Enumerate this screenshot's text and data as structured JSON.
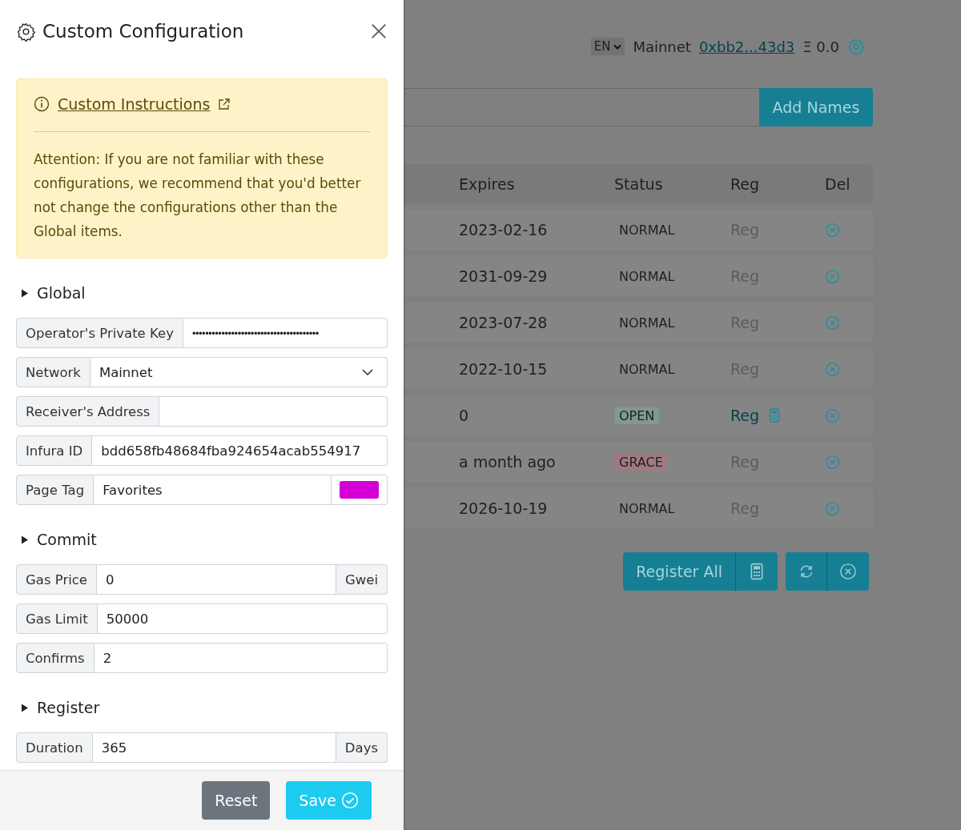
{
  "header": {
    "language": "EN",
    "network": "Mainnet",
    "account": "0xbb2...43d3",
    "balance_symbol": "Ξ",
    "balance": "0.0"
  },
  "name_input": {
    "button": "Add Names"
  },
  "table": {
    "columns": [
      "Expires",
      "Status",
      "Reg",
      "Del"
    ],
    "rows": [
      {
        "expires": "2023-02-16",
        "status": "NORMAL",
        "kind": "normal",
        "reg": "Reg",
        "reg_enabled": false
      },
      {
        "expires": "2031-09-29",
        "status": "NORMAL",
        "kind": "normal",
        "reg": "Reg",
        "reg_enabled": false
      },
      {
        "expires": "2023-07-28",
        "status": "NORMAL",
        "kind": "normal",
        "reg": "Reg",
        "reg_enabled": false
      },
      {
        "expires": "2022-10-15",
        "status": "NORMAL",
        "kind": "normal",
        "reg": "Reg",
        "reg_enabled": false
      },
      {
        "expires": "0",
        "status": "OPEN",
        "kind": "open",
        "reg": "Reg",
        "reg_enabled": true
      },
      {
        "expires": "a month ago",
        "status": "GRACE",
        "kind": "grace",
        "reg": "Reg",
        "reg_enabled": false
      },
      {
        "expires": "2026-10-19",
        "status": "NORMAL",
        "kind": "normal",
        "reg": "Reg",
        "reg_enabled": false
      }
    ]
  },
  "actions": {
    "register_all": "Register All"
  },
  "drawer": {
    "title": "Custom Configuration",
    "alert": {
      "link": "Custom Instructions",
      "message": "Attention: If you are not familiar with these configurations, we recommend that you'd better not change the configurations other than the Global items."
    },
    "sections": [
      {
        "title": "Global",
        "fields": [
          {
            "kind": "text",
            "label": "Operator's Private Key",
            "value": "•••••••••••••••••••••••••••••••••••••••"
          },
          {
            "kind": "select",
            "label": "Network",
            "value": "Mainnet"
          },
          {
            "kind": "text",
            "label": "Receiver's Address"
          },
          {
            "kind": "text",
            "label": "Infura ID",
            "value": "bdd658fb48684fba924654acab554917"
          },
          {
            "kind": "color",
            "label": "Page Tag",
            "value": "Favorites",
            "color": "#d600d6"
          }
        ]
      },
      {
        "title": "Commit",
        "fields": [
          {
            "kind": "text",
            "label": "Gas Price",
            "value": "0",
            "suffix": "Gwei"
          },
          {
            "kind": "text",
            "label": "Gas Limit",
            "value": "50000"
          },
          {
            "kind": "text",
            "label": "Confirms",
            "value": "2"
          }
        ]
      },
      {
        "title": "Register",
        "fields": [
          {
            "kind": "text",
            "label": "Duration",
            "value": "365",
            "suffix": "Days"
          }
        ]
      }
    ]
  },
  "footer": {
    "reset": "Reset",
    "save": "Save"
  }
}
